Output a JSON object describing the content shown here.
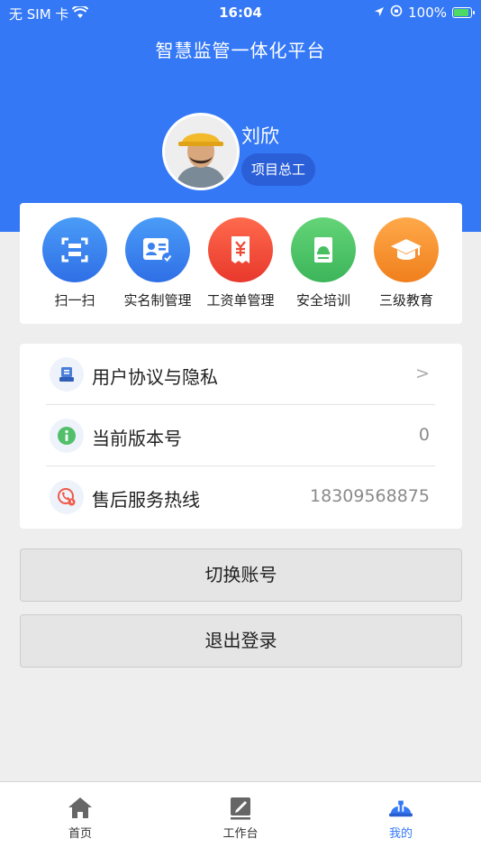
{
  "status_bar": {
    "carrier": "无 SIM 卡",
    "time": "16:04",
    "battery": "100%"
  },
  "header": {
    "title": "智慧监管一体化平台"
  },
  "profile": {
    "name": "刘欣",
    "role": "项目总工"
  },
  "quick_actions": [
    {
      "label": "扫一扫",
      "icon": "scan-icon",
      "color_start": "#4a9cf8",
      "color_end": "#2f6fe6"
    },
    {
      "label": "实名制管理",
      "icon": "id-card-icon",
      "color_start": "#4a9cf8",
      "color_end": "#2f6fe6"
    },
    {
      "label": "工资单管理",
      "icon": "payroll-icon",
      "color_start": "#ff6a4d",
      "color_end": "#e8382c"
    },
    {
      "label": "安全培训",
      "icon": "safety-book-icon",
      "color_start": "#64d478",
      "color_end": "#3cb55a"
    },
    {
      "label": "三级教育",
      "icon": "graduation-cap-icon",
      "color_start": "#ffa94a",
      "color_end": "#f07f1c"
    }
  ],
  "settings_list": [
    {
      "label": "用户协议与隐私",
      "value": ">",
      "icon": "document-icon"
    },
    {
      "label": "当前版本号",
      "value": "0",
      "icon": "info-icon"
    },
    {
      "label": "售后服务热线",
      "value": "18309568875",
      "icon": "phone-icon"
    }
  ],
  "buttons": {
    "switch_account": "切换账号",
    "logout": "退出登录"
  },
  "tabbar": [
    {
      "label": "首页",
      "icon": "home-icon",
      "active": false
    },
    {
      "label": "工作台",
      "icon": "workbench-icon",
      "active": false
    },
    {
      "label": "我的",
      "icon": "helmet-icon",
      "active": true
    }
  ],
  "colors": {
    "primary": "#3478f6",
    "background": "#eeeeee"
  }
}
